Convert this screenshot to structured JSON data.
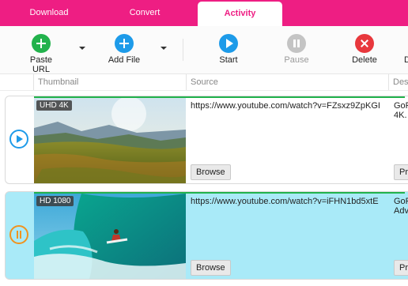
{
  "tabs": [
    {
      "label": "Download"
    },
    {
      "label": "Convert"
    },
    {
      "label": "Activity",
      "active": true
    }
  ],
  "toolbar": {
    "paste_url": "Paste URL",
    "add_file": "Add File",
    "start": "Start",
    "pause": "Pause",
    "delete": "Delete",
    "cut_label": "D"
  },
  "columns": {
    "thumbnail": "Thumbnail",
    "source": "Source",
    "description": "Des"
  },
  "rows": [
    {
      "quality": "UHD 4K",
      "source": "https://www.youtube.com/watch?v=FZsxz9ZpKGI",
      "desc_line1": "GoP",
      "desc_line2": "4K.",
      "browse": "Browse",
      "preset": "Pre",
      "state": "play",
      "progress": 0.99
    },
    {
      "quality": "HD 1080",
      "source": "https://www.youtube.com/watch?v=iFHN1bd5xtE",
      "desc_line1": "GoP",
      "desc_line2": "Adv",
      "browse": "Browse",
      "preset": "Pre",
      "state": "paused",
      "progress": 0.99
    }
  ],
  "colors": {
    "brand_pink": "#ee1e83",
    "green": "#22b24c",
    "blue": "#1e9be9",
    "red": "#e8383d",
    "orange": "#f0931e",
    "active_row": "#a9eaf8"
  }
}
